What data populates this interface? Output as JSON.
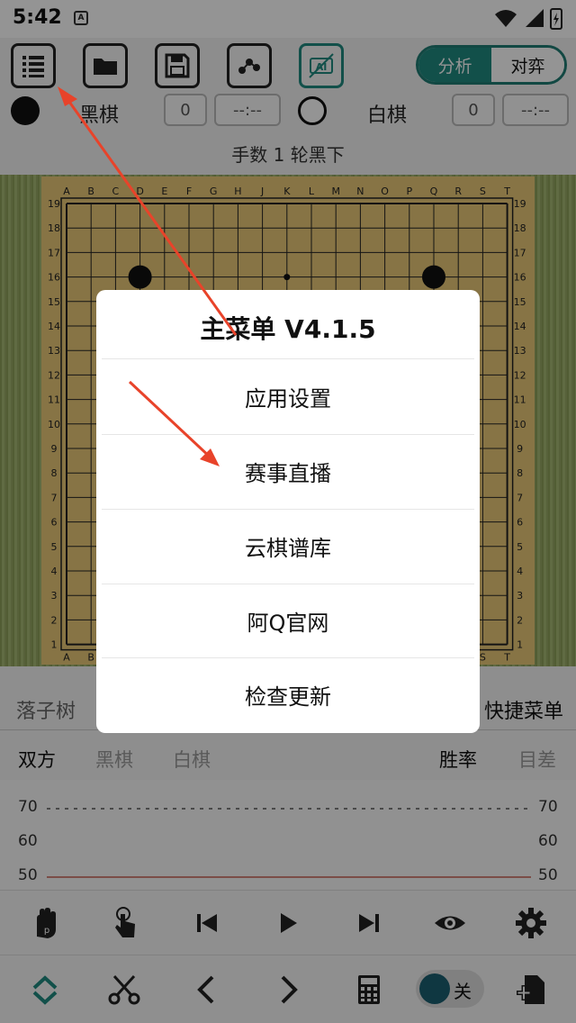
{
  "status": {
    "time": "5:42",
    "app_badge": "A"
  },
  "toolbar": {
    "buttons": [
      {
        "name": "menu-list-button",
        "icon": "list-icon"
      },
      {
        "name": "open-folder-button",
        "icon": "folder-icon"
      },
      {
        "name": "save-button",
        "icon": "floppy-disk-icon"
      },
      {
        "name": "share-button",
        "icon": "share-nodes-icon"
      },
      {
        "name": "ai-toggle-button",
        "icon": "ai-off-icon"
      }
    ],
    "ai_label": "AI",
    "mode_analysis": "分析",
    "mode_play": "对弈"
  },
  "players": {
    "black_name": "黑棋",
    "black_count": "0",
    "black_time": "--:--",
    "white_name": "白棋",
    "white_count": "0",
    "white_time": "--:--"
  },
  "move_status": "手数 1  轮黑下",
  "board": {
    "letters": [
      "A",
      "B",
      "C",
      "D",
      "E",
      "F",
      "G",
      "H",
      "J",
      "K",
      "L",
      "M",
      "N",
      "O",
      "P",
      "Q",
      "R",
      "S",
      "T"
    ],
    "numbers": [
      "19",
      "18",
      "17",
      "16",
      "15",
      "14",
      "13",
      "12",
      "11",
      "10",
      "9",
      "8",
      "7",
      "6",
      "5",
      "4",
      "3",
      "2",
      "1"
    ],
    "stones": [
      {
        "col": "D",
        "row": "16",
        "color": "black"
      },
      {
        "col": "Q",
        "row": "16",
        "color": "black"
      }
    ],
    "star_points_visible": [
      {
        "col": "K",
        "row": "16"
      }
    ]
  },
  "panel": {
    "tree_tab": "落子树",
    "shortcut_menu": "快捷菜单",
    "filters": {
      "both": "双方",
      "black": "黑棋",
      "white": "白棋",
      "winrate": "胜率",
      "score_diff": "目差"
    },
    "chart_ticks": [
      "70",
      "60",
      "50"
    ]
  },
  "controls": {
    "row1": [
      "pass-hand-icon",
      "touch-hand-icon",
      "first-move-icon",
      "play-icon",
      "last-move-icon",
      "eye-icon",
      "gear-icon"
    ],
    "row2": [
      "collapse-icon",
      "scissors-icon",
      "prev-icon",
      "next-icon",
      "calculator-icon",
      "toggle",
      "add-file-icon"
    ],
    "toggle_label": "关"
  },
  "dialog": {
    "title": "主菜单 V4.1.5",
    "items": [
      "应用设置",
      "赛事直播",
      "云棋谱库",
      "阿Q官网",
      "检查更新"
    ]
  },
  "colors": {
    "accent": "#1f8a80",
    "annotation_arrow": "#e8432a"
  }
}
